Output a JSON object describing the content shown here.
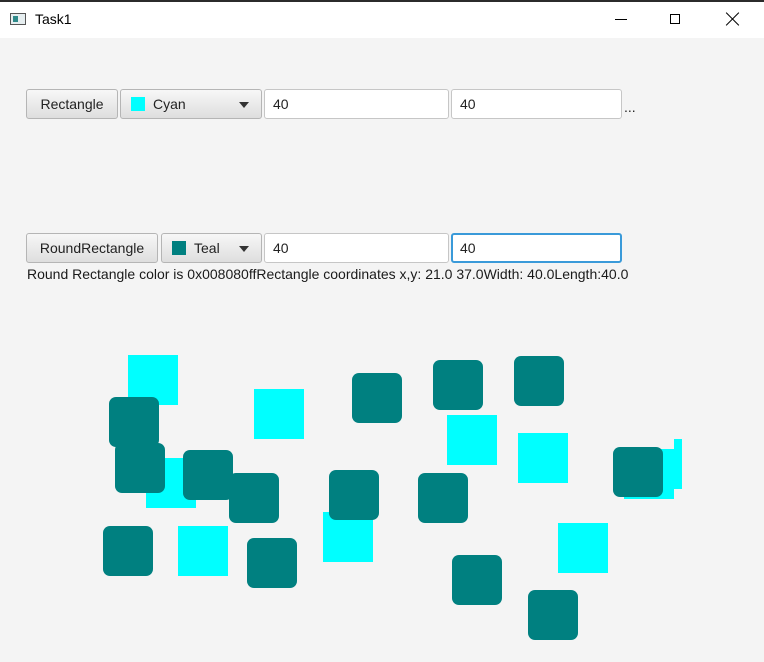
{
  "window": {
    "title": "Task1"
  },
  "row1": {
    "button_label": "Rectangle",
    "color_label": "Cyan",
    "color_hex": "#00ffff",
    "width_value": "40",
    "length_value": "40",
    "overflow_text": "..."
  },
  "row2": {
    "button_label": "RoundRectangle",
    "color_label": "Teal",
    "color_hex": "#008080",
    "width_value": "40",
    "length_value": "40"
  },
  "status_text": "Round Rectangle color is 0x008080ffRectangle coordinates x,y: 21.0 37.0Width: 40.0Length:40.0",
  "shapes": {
    "colors": {
      "cyan": "#00ffff",
      "teal": "#008080"
    }
  }
}
